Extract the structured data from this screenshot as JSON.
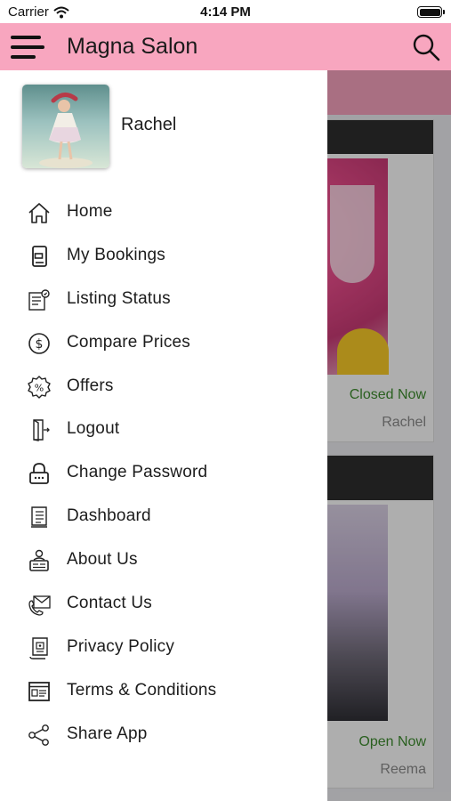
{
  "status_bar": {
    "carrier": "Carrier",
    "time": "4:14 PM"
  },
  "app_bar": {
    "title": "Magna Salon"
  },
  "drawer": {
    "user_name": "Rachel",
    "menu": [
      {
        "label": "Home",
        "icon": "home-icon"
      },
      {
        "label": "My Bookings",
        "icon": "bookings-icon"
      },
      {
        "label": "Listing Status",
        "icon": "listing-status-icon"
      },
      {
        "label": "Compare Prices",
        "icon": "dollar-icon"
      },
      {
        "label": "Offers",
        "icon": "percent-badge-icon"
      },
      {
        "label": "Logout",
        "icon": "logout-door-icon"
      },
      {
        "label": "Change Password",
        "icon": "lock-icon"
      },
      {
        "label": "Dashboard",
        "icon": "dashboard-book-icon"
      },
      {
        "label": "About Us",
        "icon": "about-icon"
      },
      {
        "label": "Contact Us",
        "icon": "contact-icon"
      },
      {
        "label": "Privacy Policy",
        "icon": "privacy-document-icon"
      },
      {
        "label": "Terms & Conditions",
        "icon": "terms-icon"
      },
      {
        "label": "Share App",
        "icon": "share-icon"
      }
    ]
  },
  "listings": [
    {
      "status": "Closed Now",
      "owner": "Rachel"
    },
    {
      "status": "Open Now",
      "owner": "Reema"
    }
  ]
}
